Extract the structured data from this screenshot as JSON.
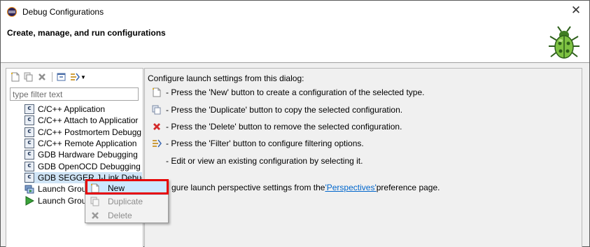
{
  "window": {
    "title": "Debug Configurations",
    "close_glyph": "✕"
  },
  "banner": {
    "heading": "Create, manage, and run configurations"
  },
  "toolbar": {
    "icons": [
      "new-config-icon",
      "duplicate-icon",
      "delete-icon",
      "collapse-all-icon",
      "filter-icon",
      "chevron-down-icon"
    ]
  },
  "filter": {
    "placeholder": "type filter text",
    "value": ""
  },
  "tree": {
    "items": [
      {
        "label": "C/C++ Application",
        "icon": "c-config-icon"
      },
      {
        "label": "C/C++ Attach to Applicatior",
        "icon": "c-config-icon"
      },
      {
        "label": "C/C++ Postmortem Debugg",
        "icon": "c-config-icon"
      },
      {
        "label": "C/C++ Remote Application",
        "icon": "c-config-icon"
      },
      {
        "label": "GDB Hardware Debugging",
        "icon": "c-config-icon"
      },
      {
        "label": "GDB OpenOCD Debugging",
        "icon": "c-config-icon"
      },
      {
        "label": "GDB SEGGER J-Link Debugg",
        "icon": "c-config-icon",
        "selected": true
      },
      {
        "label": "Launch Group",
        "icon": "launch-group-icon"
      },
      {
        "label": "Launch Group",
        "icon": "launch-run-icon"
      }
    ]
  },
  "help": {
    "intro": "Configure launch settings from this dialog:",
    "rows": [
      {
        "text": "- Press the 'New' button to create a configuration of the selected type.",
        "icon": "new-config-icon"
      },
      {
        "text": "- Press the 'Duplicate' button to copy the selected configuration.",
        "icon": "duplicate-icon"
      },
      {
        "text": "- Press the 'Delete' button to remove the selected configuration.",
        "icon": "delete-icon"
      },
      {
        "text": "- Press the 'Filter' button to configure filtering options.",
        "icon": "filter-icon"
      },
      {
        "text": "- Edit or view an existing configuration by selecting it.",
        "icon": ""
      }
    ],
    "perspective_prefix": "gure launch perspective settings from the ",
    "perspective_link": "'Perspectives'",
    "perspective_suffix": " preference page."
  },
  "context_menu": {
    "items": [
      {
        "label": "New",
        "icon": "new-config-icon",
        "enabled": true,
        "highlighted": true
      },
      {
        "label": "Duplicate",
        "icon": "duplicate-icon",
        "enabled": false
      },
      {
        "label": "Delete",
        "icon": "delete-icon",
        "enabled": false
      }
    ]
  },
  "colors": {
    "highlight": "#e60000",
    "selection": "#cfe4f6",
    "link": "#0066cc"
  }
}
